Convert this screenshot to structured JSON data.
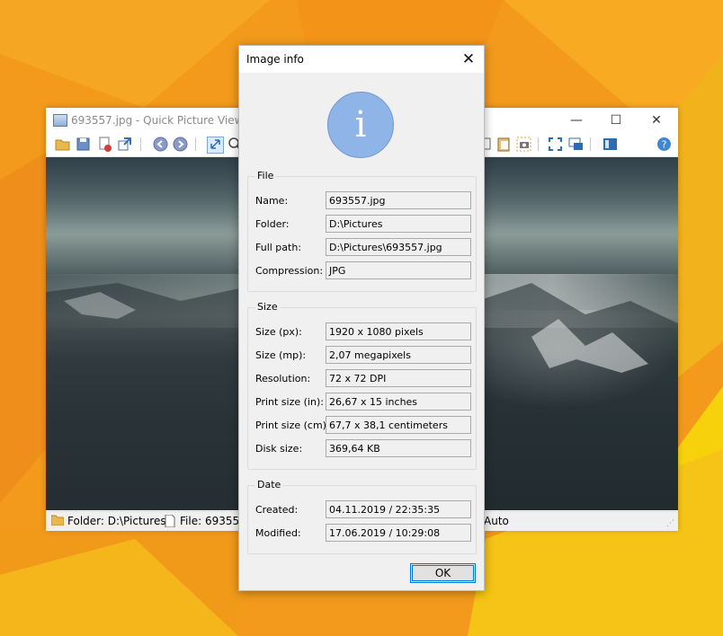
{
  "colors": {
    "desktop_accent": "#f7a21b",
    "desktop_yellow": "#f5d20a",
    "info_icon": "#8fb4e8",
    "focus": "#0078d7"
  },
  "viewer": {
    "title": "693557.jpg - Quick Picture Viewer",
    "controls": {
      "minimize": "—",
      "maximize": "☐",
      "close": "✕"
    },
    "status": {
      "folder": "Folder: D:\\Pictures",
      "file": "File: 693557,",
      "zoom": "Auto"
    }
  },
  "dialog": {
    "title": "Image info",
    "close_glyph": "✕",
    "icon_glyph": "i",
    "file_group": {
      "label": "File",
      "rows": [
        {
          "label": "Name:",
          "value": "693557.jpg"
        },
        {
          "label": "Folder:",
          "value": "D:\\Pictures"
        },
        {
          "label": "Full path:",
          "value": "D:\\Pictures\\693557.jpg"
        },
        {
          "label": "Compression:",
          "value": "JPG"
        }
      ]
    },
    "size_group": {
      "label": "Size",
      "rows": [
        {
          "label": "Size (px):",
          "value": "1920 x 1080 pixels"
        },
        {
          "label": "Size (mp):",
          "value": "2,07 megapixels"
        },
        {
          "label": "Resolution:",
          "value": "72 x 72 DPI"
        },
        {
          "label": "Print size (in):",
          "value": "26,67 x 15 inches"
        },
        {
          "label": "Print size (cm):",
          "value": "67,7 x 38,1 centimeters"
        },
        {
          "label": "Disk size:",
          "value": "369,64 KB"
        }
      ]
    },
    "date_group": {
      "label": "Date",
      "rows": [
        {
          "label": "Created:",
          "value": "04.11.2019 / 22:35:35"
        },
        {
          "label": "Modified:",
          "value": "17.06.2019 / 10:29:08"
        }
      ]
    },
    "ok_label": "OK"
  }
}
